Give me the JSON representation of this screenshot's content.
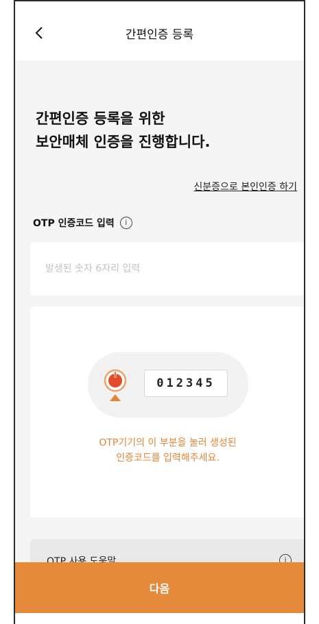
{
  "header": {
    "title": "간편인증 등록",
    "back_icon": "chevron-left-icon"
  },
  "headline": {
    "line1": "간편인증 등록을 위한",
    "line2": "보안매체 인증을 진행합니다."
  },
  "id_auth_link": "신분증으로 본인인증 하기",
  "otp": {
    "label": "OTP 인증코드 입력",
    "info_icon_glyph": "i",
    "input_value": "",
    "placeholder": "발생된 숫자 6자리 입력"
  },
  "guide": {
    "sample_code": "012345",
    "text_line1": "OTP기기의 이 부분을 눌러 생성된",
    "text_line2": "인증코드를 입력해주세요.",
    "accent_color": "#e48535"
  },
  "help": {
    "label": "OTP 사용 도움말",
    "info_icon_glyph": "i"
  },
  "next_button": {
    "label": "다음",
    "color": "#e58a3b"
  }
}
